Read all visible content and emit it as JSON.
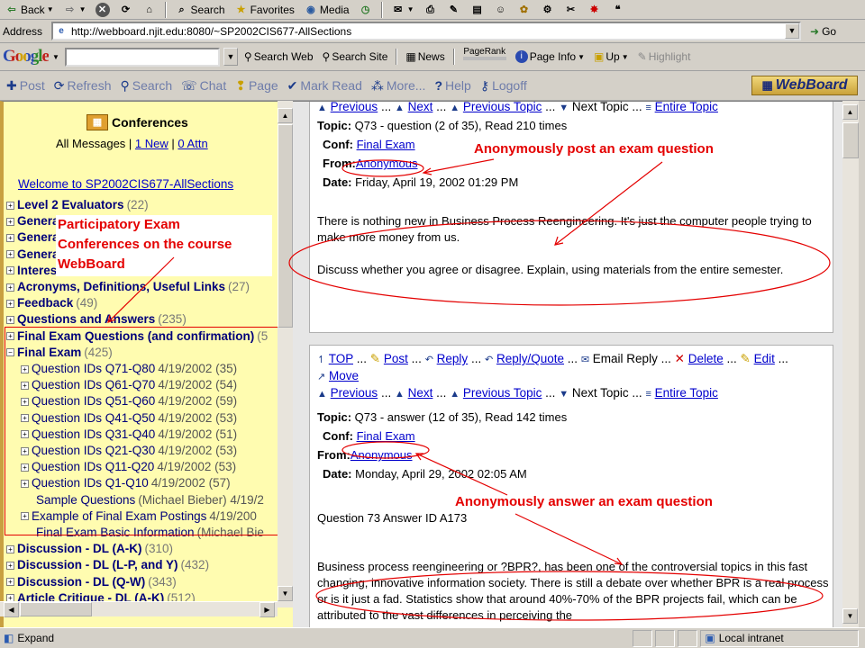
{
  "toolbar": {
    "back": "Back",
    "search": "Search",
    "favorites": "Favorites",
    "media": "Media"
  },
  "address": {
    "label": "Address",
    "url": "http://webboard.njit.edu:8080/~SP2002CIS677-AllSections",
    "go": "Go"
  },
  "google": {
    "logo": "Google",
    "search_web": "Search Web",
    "search_site": "Search Site",
    "news": "News",
    "pagerank": "PageRank",
    "page_info": "Page Info",
    "up": "Up",
    "highlight": "Highlight"
  },
  "webboard_bar": {
    "post": "Post",
    "refresh": "Refresh",
    "search": "Search",
    "chat": "Chat",
    "page": "Page",
    "mark_read": "Mark Read",
    "more": "More...",
    "help": "Help",
    "logoff": "Logoff",
    "logo": "WebBoard"
  },
  "sidebar": {
    "title": "Conferences",
    "all_messages": "All Messages |",
    "new_link": "1 New",
    "sep": "|",
    "attn_link": "0 Attn",
    "welcome": "Welcome to SP2002CIS677-AllSections",
    "categories": [
      {
        "name": "Level 2 Evaluators",
        "count": "(22)"
      },
      {
        "name": "General",
        "count": ""
      },
      {
        "name": "General",
        "count": ""
      },
      {
        "name": "General",
        "count": ""
      },
      {
        "name": "Interest",
        "count": ""
      },
      {
        "name": "Acronyms, Definitions, Useful Links",
        "count": "(27)"
      },
      {
        "name": "Feedback",
        "count": "(49)"
      },
      {
        "name": "Questions and Answers",
        "count": "(235)"
      },
      {
        "name": "Final Exam Questions (and confirmation)",
        "count": "(5"
      },
      {
        "name": "Final Exam",
        "count": "(425)"
      }
    ],
    "sub_items": [
      {
        "name": "Question IDs Q71-Q80",
        "date": "4/19/2002 (35)"
      },
      {
        "name": "Question IDs Q61-Q70",
        "date": "4/19/2002 (54)"
      },
      {
        "name": "Question IDs Q51-Q60",
        "date": "4/19/2002 (59)"
      },
      {
        "name": "Question IDs Q41-Q50",
        "date": "4/19/2002 (53)"
      },
      {
        "name": "Question IDs Q31-Q40",
        "date": "4/19/2002 (51)"
      },
      {
        "name": "Question IDs Q21-Q30",
        "date": "4/19/2002 (53)"
      },
      {
        "name": "Question IDs Q11-Q20",
        "date": "4/19/2002 (53)"
      },
      {
        "name": "Question IDs Q1-Q10",
        "date": "4/19/2002 (57)"
      }
    ],
    "sample": "Sample Questions",
    "sample_meta": "(Michael Bieber) 4/19/2",
    "example": "Example of Final Exam Postings",
    "example_date": "4/19/200",
    "basic": "Final Exam Basic Information",
    "basic_meta": "(Michael Bie",
    "bottom_categories": [
      {
        "name": "Discussion - DL (A-K)",
        "count": "(310)"
      },
      {
        "name": "Discussion - DL (L-P, and Y)",
        "count": "(432)"
      },
      {
        "name": "Discussion - DL (Q-W)",
        "count": "(343)"
      },
      {
        "name": "Article Critique - DL (A-K)",
        "count": "(512)"
      }
    ],
    "annotation": [
      "Participatory Exam",
      "Conferences on the course",
      "WebBoard"
    ]
  },
  "post1": {
    "nav": {
      "previous": "Previous",
      "next": "Next",
      "previous_topic": "Previous Topic",
      "next_topic": "Next Topic",
      "entire_topic": "Entire Topic",
      "ellipsis": "..."
    },
    "topic_label": "Topic:",
    "topic": "Q73 - question (2 of 35), Read 210 times",
    "conf_label": "Conf:",
    "conf": "Final Exam",
    "from_label": "From:",
    "from": "Anonymous",
    "date_label": "Date:",
    "date": "Friday, April 19, 2002 01:29 PM",
    "body1": "There is nothing new in Business Process Reengineering. It's just the computer people trying to make more money from us.",
    "body2": "Discuss whether you agree or disagree. Explain, using materials from the entire semester.",
    "annotation": "Anonymously post an exam question"
  },
  "post2": {
    "actions": {
      "top": "TOP",
      "post": "Post",
      "reply": "Reply",
      "reply_quote": "Reply/Quote",
      "email_reply": "Email Reply",
      "delete": "Delete",
      "edit": "Edit",
      "move": "Move",
      "ellipsis": "..."
    },
    "nav": {
      "previous": "Previous",
      "next": "Next",
      "previous_topic": "Previous Topic",
      "next_topic": "Next Topic",
      "entire_topic": "Entire Topic",
      "ellipsis": "..."
    },
    "topic_label": "Topic:",
    "topic": "Q73 - answer (12 of 35), Read 142 times",
    "conf_label": "Conf:",
    "conf": "Final Exam",
    "from_label": "From:",
    "from": "Anonymous",
    "date_label": "Date:",
    "date": "Monday, April 29, 2002 02:05 AM",
    "answer_id": "Question 73 Answer ID A173",
    "body": "Business process reengineering or ?BPR?, has been one of the controversial topics in this fast changing, innovative information society. There is still a debate over whether BPR is a real process or is it just a fad. Statistics show that around 40%-70% of the BPR projects fail, which can be attributed to the vast differences in perceiving the",
    "annotation": "Anonymously answer an exam question"
  },
  "status": {
    "left": "Expand",
    "zone": "Local intranet"
  }
}
